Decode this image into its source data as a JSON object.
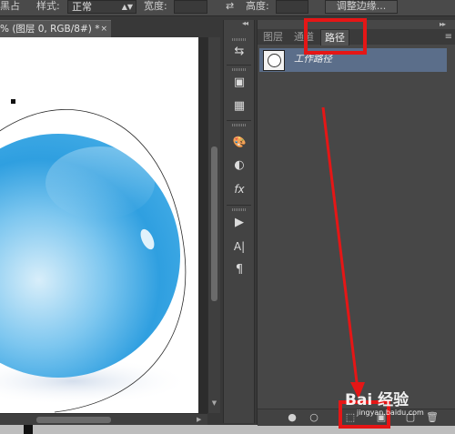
{
  "options_bar": {
    "mode_fragment": "黑占",
    "style_label": "样式:",
    "style_value": "正常",
    "width_label": "宽度:",
    "height_label": "高度:",
    "refine_edge_button": "调整边缘..."
  },
  "document": {
    "tab_title": "% (图层 0, RGB/8#) *",
    "close_glyph": "×"
  },
  "panel": {
    "collapse_glyph": "◂◂",
    "expand_glyph": "▸▸",
    "tabs": [
      {
        "label": "图层",
        "active": false
      },
      {
        "label": "通道",
        "active": false
      },
      {
        "label": "路径",
        "active": true
      }
    ],
    "menu_glyph": "≡",
    "paths": [
      {
        "name": "工作路径",
        "icon": "circle-path-thumbnail"
      }
    ],
    "footer_icons": [
      "fill-path-icon",
      "stroke-path-icon",
      "load-as-selection-icon",
      "make-mask-icon",
      "new-path-icon",
      "delete-path-icon"
    ]
  },
  "tools": [
    {
      "name": "history-icon",
      "glyph": "⇆"
    },
    {
      "name": "3d-icon",
      "glyph": "▣"
    },
    {
      "name": "grid-icon",
      "glyph": "▦"
    },
    {
      "name": "swatches-icon",
      "glyph": "🎨"
    },
    {
      "name": "adjustments-icon",
      "glyph": "◐"
    },
    {
      "name": "styles-icon",
      "glyph": "fx"
    },
    {
      "name": "actions-play-icon",
      "glyph": "▶"
    },
    {
      "name": "character-icon",
      "glyph": "A|"
    },
    {
      "name": "paragraph-icon",
      "glyph": "¶"
    }
  ],
  "watermark": {
    "brand": "Bai  经验",
    "url": "jingyan.baidu.com"
  },
  "colors": {
    "highlight": "#e51616",
    "selected_row": "#5b6e8a",
    "panel_bg": "#474747"
  }
}
